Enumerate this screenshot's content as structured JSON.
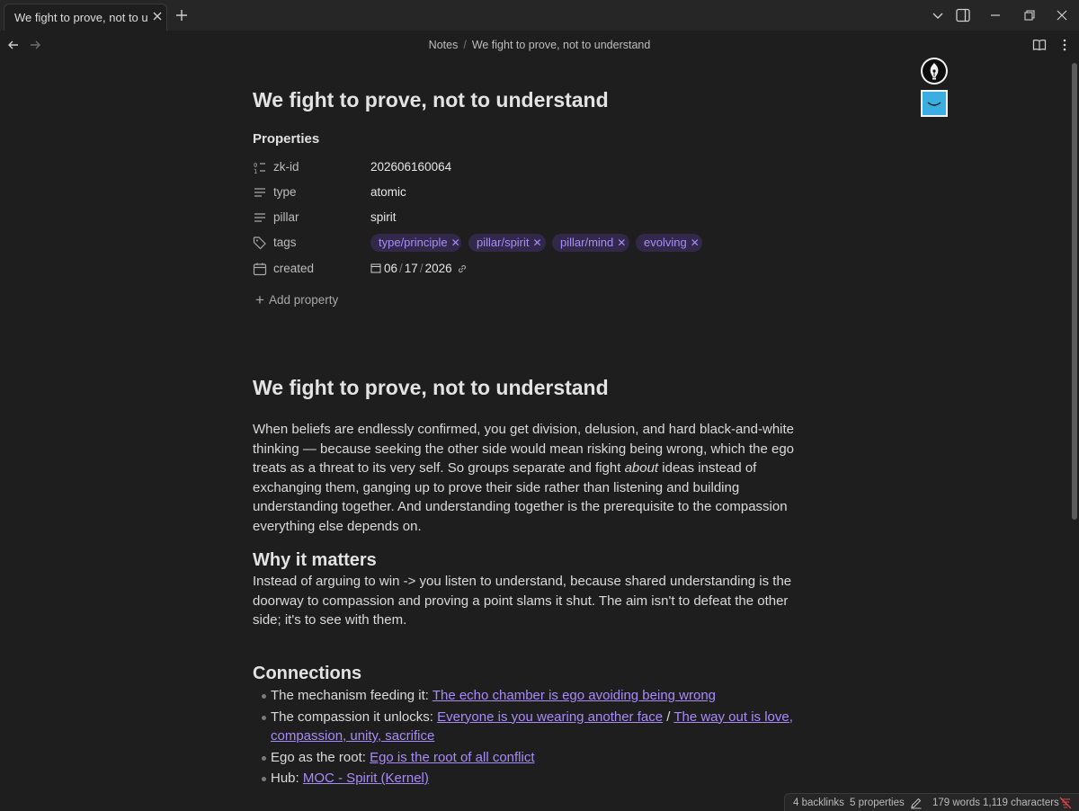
{
  "tab": {
    "title": "We fight to prove, not to u..."
  },
  "breadcrumb": {
    "folder": "Notes",
    "separator": "/",
    "current": "We fight to prove, not to understand"
  },
  "note": {
    "inline_title": "We fight to prove, not to understand",
    "properties_heading": "Properties",
    "properties": [
      {
        "key": "zk-id",
        "value": "202606160064",
        "icon": "number-list-icon"
      },
      {
        "key": "type",
        "value": "atomic",
        "icon": "text-lines-icon"
      },
      {
        "key": "pillar",
        "value": "spirit",
        "icon": "text-lines-icon"
      },
      {
        "key": "tags",
        "icon": "tag-icon",
        "tags": [
          "type/principle",
          "pillar/spirit",
          "pillar/mind",
          "evolving"
        ]
      },
      {
        "key": "created",
        "icon": "calendar-icon",
        "date": {
          "month": "06",
          "day": "17",
          "year": "2026"
        }
      }
    ],
    "add_property": "Add property",
    "h1": "We fight to prove, not to understand",
    "intro": {
      "before": "When beliefs are endlessly confirmed, you get division, delusion, and hard black-and-white thinking — because seeking the other side would mean risking being wrong, which the ego treats as a threat to its very self. So groups separate and fight ",
      "emphasis": "about",
      "after": " ideas instead of exchanging them, ganging up to prove their side rather than listening and building understanding together. And understanding together is the prerequisite to the compassion everything else depends on."
    },
    "why_heading": "Why it matters",
    "why_text": "Instead of arguing to win -> you listen to understand, because shared understanding is the doorway to compassion and proving a point slams it shut. The aim isn't to defeat the other side; it's to see with them.",
    "connections_heading": "Connections",
    "connections": [
      {
        "prefix": "The mechanism feeding it: ",
        "link1": "The echo chamber is ego avoiding being wrong"
      },
      {
        "prefix": "The compassion it unlocks: ",
        "link1": "Everyone is you wearing another face",
        "between": " / ",
        "link2": "The way out is love, compassion, unity, sacrifice"
      },
      {
        "prefix": "Ego as the root: ",
        "link1": "Ego is the root of all conflict"
      },
      {
        "prefix": "Hub: ",
        "link1": "MOC - Spirit (Kernel)"
      }
    ]
  },
  "status": {
    "backlinks": "4 backlinks",
    "properties": "5 properties",
    "words": "179 words",
    "characters": "1,119 characters"
  },
  "colors": {
    "accent": "#a88bfa",
    "background": "#1e1e1e",
    "tag_bg": "#32294a",
    "titlebar": "#262626"
  }
}
